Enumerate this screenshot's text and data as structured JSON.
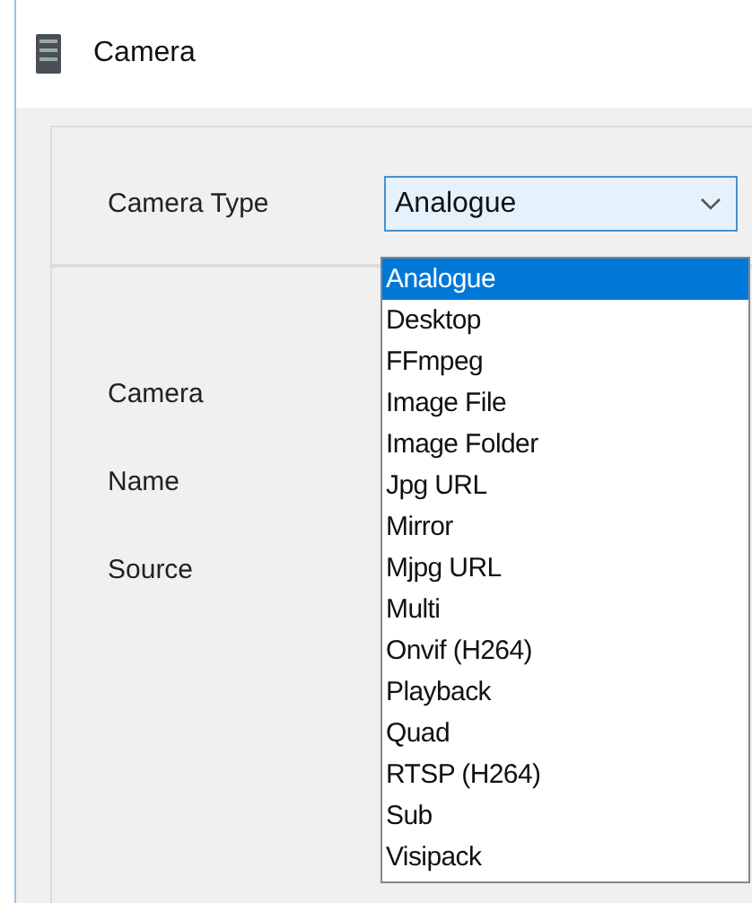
{
  "window": {
    "title": "Camera"
  },
  "camera_type": {
    "label": "Camera Type",
    "value": "Analogue",
    "expanded": true,
    "options": [
      {
        "label": "Analogue",
        "selected": true
      },
      {
        "label": "Desktop",
        "selected": false
      },
      {
        "label": "FFmpeg",
        "selected": false
      },
      {
        "label": "Image File",
        "selected": false
      },
      {
        "label": "Image Folder",
        "selected": false
      },
      {
        "label": "Jpg URL",
        "selected": false
      },
      {
        "label": "Mirror",
        "selected": false
      },
      {
        "label": "Mjpg URL",
        "selected": false
      },
      {
        "label": "Multi",
        "selected": false
      },
      {
        "label": "Onvif (H264)",
        "selected": false
      },
      {
        "label": "Playback",
        "selected": false
      },
      {
        "label": "Quad",
        "selected": false
      },
      {
        "label": "RTSP (H264)",
        "selected": false
      },
      {
        "label": "Sub",
        "selected": false
      },
      {
        "label": "Visipack",
        "selected": false
      }
    ]
  },
  "fields": [
    {
      "label": "Camera"
    },
    {
      "label": "Name"
    },
    {
      "label": "Source"
    }
  ]
}
